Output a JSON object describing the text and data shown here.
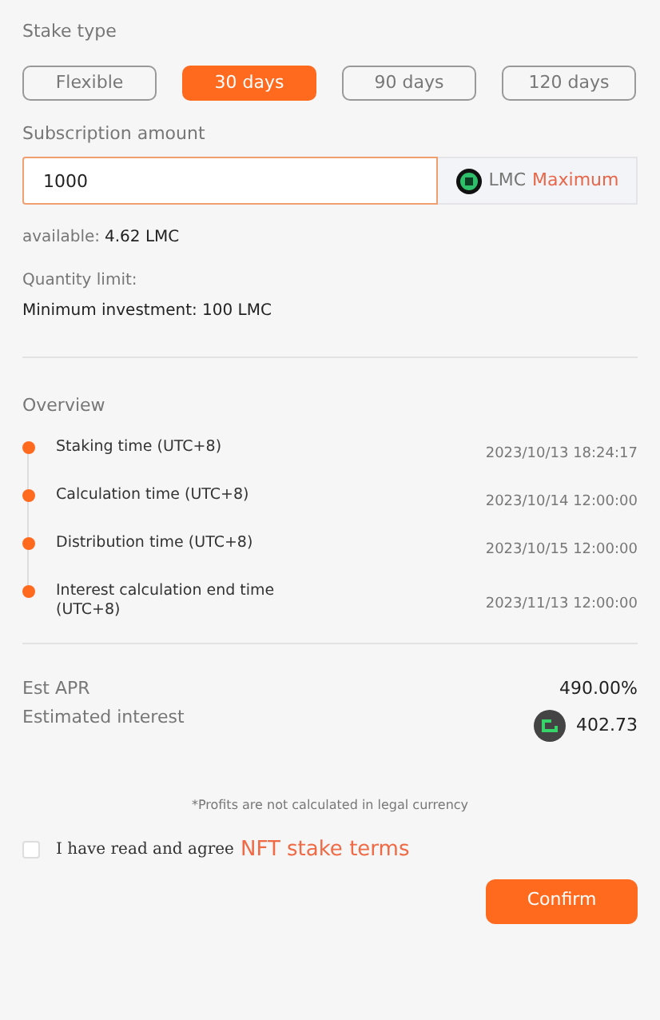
{
  "stake_type": {
    "label": "Stake type",
    "options": [
      {
        "label": "Flexible",
        "selected": false
      },
      {
        "label": "30 days",
        "selected": true
      },
      {
        "label": "90 days",
        "selected": false
      },
      {
        "label": "120 days",
        "selected": false
      }
    ]
  },
  "subscription": {
    "label": "Subscription amount",
    "value": "1000",
    "currency": "LMC",
    "max_link": "Maximum"
  },
  "available": {
    "label": "available:",
    "value": "4.62 LMC"
  },
  "quantity_limit": {
    "label": "Quantity limit:",
    "text": "Minimum investment: 100 LMC"
  },
  "overview": {
    "title": "Overview",
    "events": [
      {
        "label": "Staking time (UTC+8)",
        "time": "2023/10/13 18:24:17"
      },
      {
        "label": "Calculation time (UTC+8)",
        "time": "2023/10/14 12:00:00"
      },
      {
        "label": "Distribution time (UTC+8)",
        "time": "2023/10/15 12:00:00"
      },
      {
        "label": "Interest calculation end time (UTC+8)",
        "time": "2023/11/13 12:00:00"
      }
    ]
  },
  "est_apr": {
    "label": "Est APR",
    "value": "490.00%"
  },
  "estimated_interest": {
    "label": "Estimated interest",
    "value": "402.73"
  },
  "note": "*Profits are not calculated in legal currency",
  "agreement": {
    "checked": false,
    "text": "I have read and agree",
    "link": "NFT stake terms"
  },
  "confirm": "Confirm"
}
